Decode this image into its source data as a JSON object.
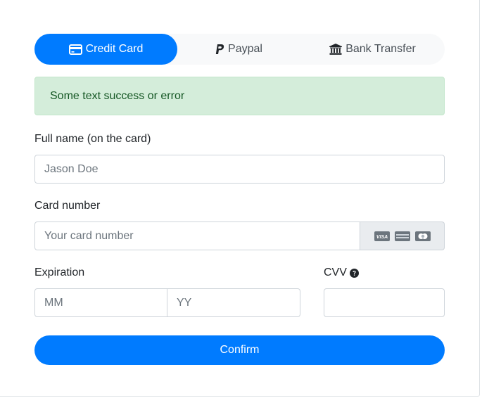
{
  "tabs": [
    {
      "label": "Credit Card",
      "icon": "credit-card-icon",
      "active": true
    },
    {
      "label": "Paypal",
      "icon": "paypal-icon",
      "active": false
    },
    {
      "label": "Bank Transfer",
      "icon": "bank-icon",
      "active": false
    }
  ],
  "alert": {
    "text": "Some text success or error"
  },
  "form": {
    "full_name_label": "Full name (on the card)",
    "full_name_placeholder": "Jason Doe",
    "card_number_label": "Card number",
    "card_number_placeholder": "Your card number",
    "card_brand_icons": [
      "visa-icon",
      "amex-icon",
      "mastercard-icon"
    ],
    "expiration_label": "Expiration",
    "mm_placeholder": "MM",
    "yy_placeholder": "YY",
    "cvv_label": "CVV",
    "cvv_help_icon": "question-circle-icon",
    "confirm_label": "Confirm"
  },
  "colors": {
    "primary": "#007bff",
    "alert_bg": "#d4edda",
    "alert_text": "#155724"
  }
}
